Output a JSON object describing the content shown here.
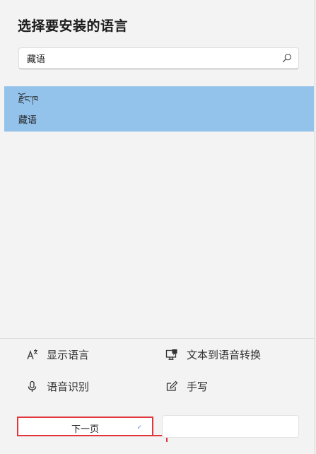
{
  "dialog": {
    "title": "选择要安装的语言"
  },
  "search": {
    "value": "藏语",
    "icon": "search-icon"
  },
  "results": [
    {
      "native_name": "རྫོང་ཁ",
      "name": "藏语",
      "selected": true
    }
  ],
  "features": {
    "display_language": {
      "label": "显示语言",
      "icon": "display-language-icon"
    },
    "text_to_speech": {
      "label": "文本到语音转换",
      "icon": "text-to-speech-icon"
    },
    "speech_recognition": {
      "label": "语音识别",
      "icon": "microphone-icon"
    },
    "handwriting": {
      "label": "手写",
      "icon": "handwriting-icon"
    }
  },
  "buttons": {
    "next_label": "下一页",
    "cancel_label": ""
  },
  "colors": {
    "selection": "#93c2ea",
    "highlight_border": "#e0363c",
    "background": "#f3f3f3"
  }
}
